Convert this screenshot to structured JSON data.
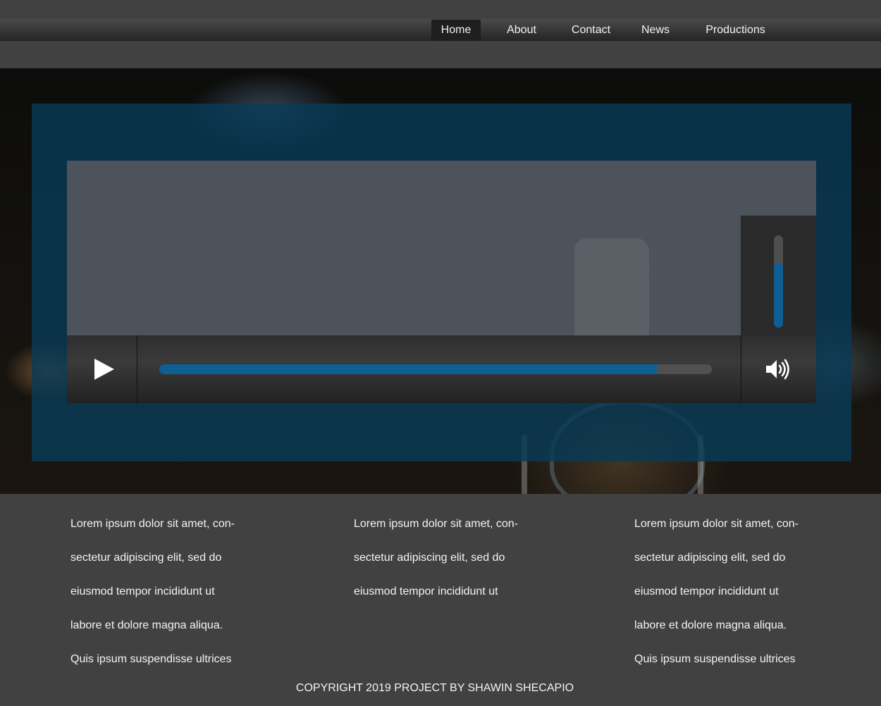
{
  "nav": {
    "items": [
      {
        "label": "Home",
        "active": true
      },
      {
        "label": "About"
      },
      {
        "label": "Contact"
      },
      {
        "label": "News"
      },
      {
        "label": "Productions"
      }
    ]
  },
  "player": {
    "progress_fraction": 0.9,
    "volume_fraction": 0.7,
    "play_icon": "play-icon",
    "volume_icon": "speaker-volume-icon",
    "accent_color": "#0d5e93"
  },
  "columns": [
    {
      "lines": [
        "Lorem ipsum dolor sit amet, con-",
        "sectetur adipiscing elit, sed do",
        "eiusmod tempor incididunt ut",
        "labore et dolore magna aliqua.",
        "Quis ipsum suspendisse ultrices"
      ]
    },
    {
      "lines": [
        "Lorem ipsum dolor sit amet, con-",
        "sectetur adipiscing elit, sed do",
        "eiusmod tempor incididunt ut"
      ]
    },
    {
      "lines": [
        "Lorem ipsum dolor sit amet, con-",
        "sectetur adipiscing elit, sed do",
        "eiusmod tempor incididunt ut",
        "labore et dolore magna aliqua.",
        "Quis ipsum suspendisse ultrices"
      ]
    }
  ],
  "footer": {
    "text": "COPYRIGHT 2019 PROJECT BY SHAWIN SHECAPIO"
  }
}
